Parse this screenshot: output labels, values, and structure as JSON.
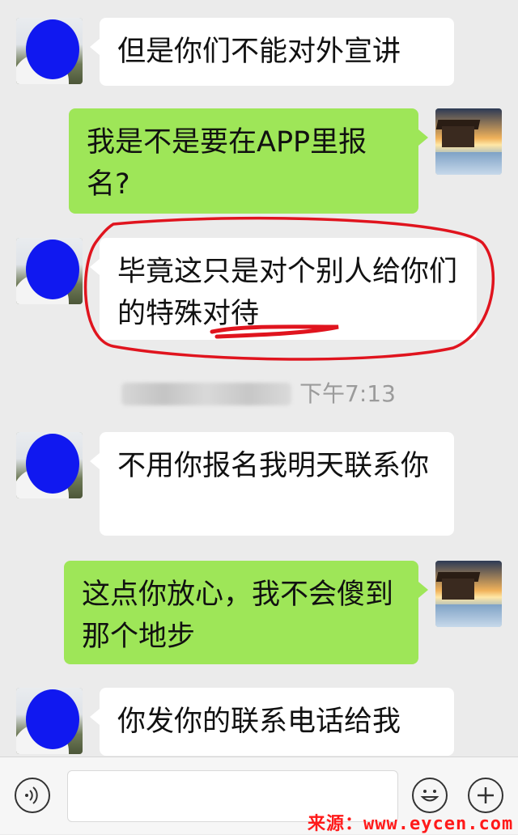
{
  "messages": [
    {
      "side": "left",
      "text": "但是你们不能对外宣讲"
    },
    {
      "side": "right",
      "text": "我是不是要在APP里报名?"
    },
    {
      "side": "left",
      "text": "毕竟这只是对个别人给你们的特殊对待"
    },
    {
      "side": "left",
      "text": "不用你报名我明天联系你"
    },
    {
      "side": "right",
      "text": "这点你放心，我不会傻到那个地步"
    },
    {
      "side": "left",
      "text": "你发你的联系电话给我"
    }
  ],
  "timestamp": "下午7:13",
  "input": {
    "placeholder": ""
  },
  "icons": {
    "voice": "voice-icon",
    "emoji": "emoji-icon",
    "plus": "plus-icon"
  },
  "watermark": "来源：www.eycen.com",
  "colors": {
    "incoming": "#ffffff",
    "outgoing": "#9ee658",
    "annotation": "#e0141e",
    "background": "#ebebeb"
  }
}
